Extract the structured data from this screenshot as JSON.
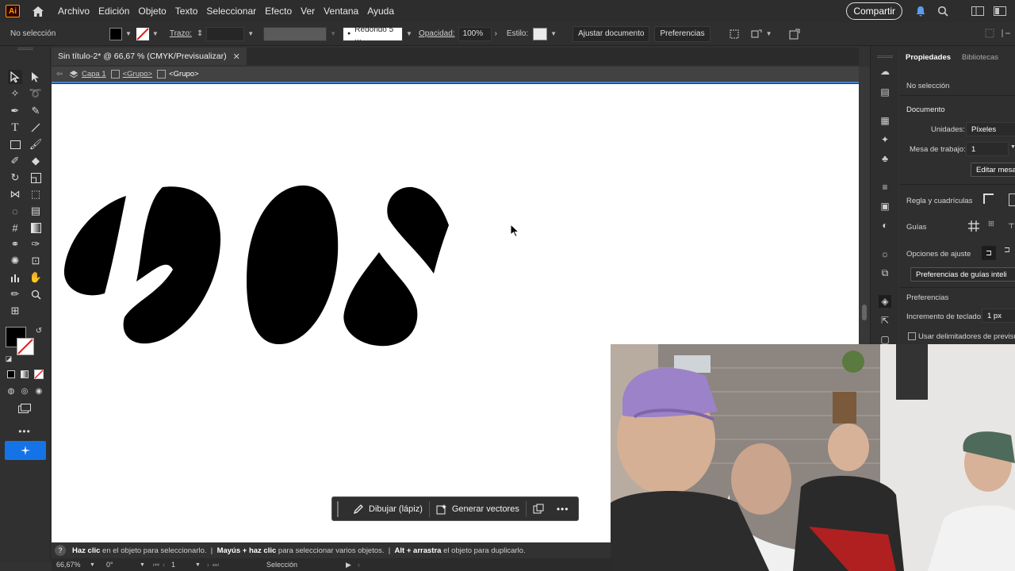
{
  "menubar": {
    "logo": "Ai",
    "items": [
      "Archivo",
      "Edición",
      "Objeto",
      "Texto",
      "Seleccionar",
      "Efecto",
      "Ver",
      "Ventana",
      "Ayuda"
    ],
    "share_label": "Compartir"
  },
  "controlbar": {
    "selection_label": "No selección",
    "stroke_label": "Trazo:",
    "brush_label": "Redondo 5 ...",
    "opacity_label": "Opacidad:",
    "opacity_value": "100%",
    "style_label": "Estilo:",
    "adjust_doc_button": "Ajustar documento",
    "prefs_button": "Preferencias"
  },
  "document": {
    "tab_title": "Sin título-2* @ 66,67 % (CMYK/Previsualizar)",
    "breadcrumb": [
      "Capa 1",
      "<Grupo>",
      "<Grupo>"
    ]
  },
  "context_bar": {
    "draw_label": "Dibujar (lápiz)",
    "generate_label": "Generar vectores"
  },
  "hint": {
    "part1_bold": "Haz clic",
    "part1": " en el objeto para seleccionarlo.  |  ",
    "part2_bold": "Mayús + haz clic",
    "part2": " para seleccionar varios objetos.  |  ",
    "part3_bold": "Alt + arrastra",
    "part3": " el objeto para duplicarlo."
  },
  "statusbar": {
    "zoom": "66,67%",
    "rotation": "0°",
    "artboard": "1",
    "mode": "Selección"
  },
  "properties": {
    "tab_properties": "Propiedades",
    "tab_libraries": "Bibliotecas",
    "no_selection": "No selección",
    "document_title": "Documento",
    "units_label": "Unidades:",
    "units_value": "Píxeles",
    "artboard_label": "Mesa de trabajo:",
    "artboard_value": "1",
    "edit_artboards": "Editar mesas",
    "rulers_label": "Regla y cuadrículas",
    "guides_label": "Guías",
    "snap_label": "Opciones de ajuste",
    "smart_guides_button": "Preferencias de guías inteli",
    "prefs_title": "Preferencias",
    "keyboard_inc_label": "Incremento de teclado:",
    "keyboard_inc_value": "1 px",
    "preview_bounds_label": "Usar delimitadores de previsual"
  }
}
